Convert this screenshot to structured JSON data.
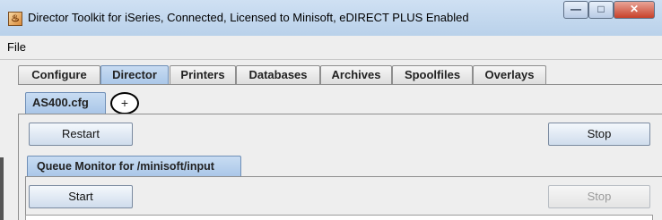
{
  "window": {
    "title": "Director Toolkit for iSeries, Connected, Licensed to Minisoft, eDIRECT PLUS Enabled",
    "app_icon": "java-app-icon",
    "controls": {
      "minimize": "—",
      "maximize": "□",
      "close": "✕"
    }
  },
  "menubar": {
    "file": "File"
  },
  "main_tabs": [
    {
      "label": "Configure",
      "active": false
    },
    {
      "label": "Director",
      "active": true
    },
    {
      "label": "Printers",
      "active": false
    },
    {
      "label": "Databases",
      "active": false
    },
    {
      "label": "Archives",
      "active": false
    },
    {
      "label": "Spoolfiles",
      "active": false
    },
    {
      "label": "Overlays",
      "active": false
    }
  ],
  "config_tab": {
    "label": "AS400.cfg",
    "add_label": "+"
  },
  "config_panel": {
    "restart_label": "Restart",
    "stop_label": "Stop"
  },
  "queue_monitor": {
    "tab_label": "Queue Monitor for /minisoft/input",
    "start_label": "Start",
    "stop_label": "Stop",
    "stop_enabled": false
  },
  "colors": {
    "active_tab": "#b9d1ea",
    "title_bar": "#c3d8ee",
    "close_button": "#c7412a"
  }
}
